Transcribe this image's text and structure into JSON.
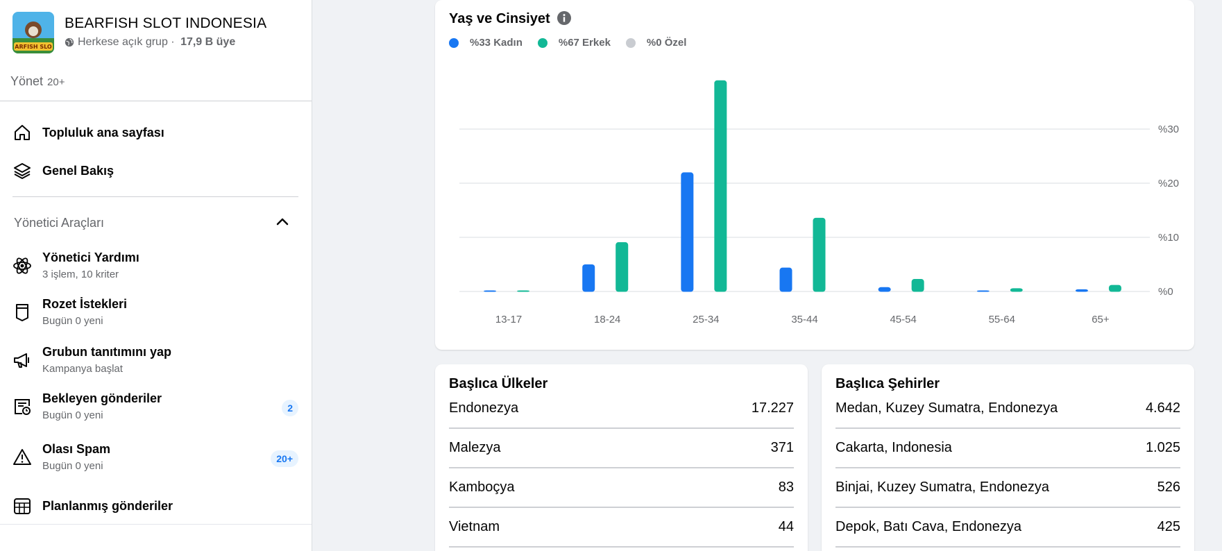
{
  "group": {
    "name": "BEARFISH SLOT INDONESIA",
    "privacy": "Herkese açık grup",
    "separator": " · ",
    "members": "17,9 B üye",
    "thumb_text": "ARFISH SLO"
  },
  "manage": {
    "label": "Yönet",
    "count": "20+"
  },
  "nav_top": [
    {
      "label": "Topluluk ana sayfası",
      "icon": "home-icon"
    },
    {
      "label": "Genel Bakış",
      "icon": "layers-icon"
    }
  ],
  "admin_tools": {
    "title": "Yönetici Araçları",
    "items": [
      {
        "label": "Yönetici Yardımı",
        "sub": "3 işlem, 10 kriter",
        "icon": "atom-icon",
        "badge": ""
      },
      {
        "label": "Rozet İstekleri",
        "sub": "Bugün 0 yeni",
        "icon": "badge-shield-icon",
        "badge": ""
      },
      {
        "label": "Grubun tanıtımını yap",
        "sub": "Kampanya başlat",
        "icon": "megaphone-icon",
        "badge": ""
      },
      {
        "label": "Bekleyen gönderiler",
        "sub": "Bugün 0 yeni",
        "icon": "pending-posts-icon",
        "badge": "2"
      },
      {
        "label": "Olası Spam",
        "sub": "Bugün 0 yeni",
        "icon": "warning-icon",
        "badge": "20+"
      },
      {
        "label": "Planlanmış gönderiler",
        "sub": "",
        "icon": "calendar-grid-icon",
        "badge": ""
      }
    ]
  },
  "age_gender": {
    "title": "Yaş ve Cinsiyet",
    "legend": [
      {
        "label": "%33 Kadın",
        "color": "#1877f2"
      },
      {
        "label": "%67 Erkek",
        "color": "#12b896"
      },
      {
        "label": "%0 Özel",
        "color": "#c9ccd1"
      }
    ]
  },
  "chart_data": {
    "type": "bar",
    "categories": [
      "13-17",
      "18-24",
      "25-34",
      "35-44",
      "45-54",
      "55-64",
      "65+"
    ],
    "series": [
      {
        "name": "Kadın",
        "color": "#1877f2",
        "values": [
          0.1,
          5.0,
          22.0,
          4.4,
          0.8,
          0.2,
          0.4
        ]
      },
      {
        "name": "Erkek",
        "color": "#12b896",
        "values": [
          0.2,
          9.1,
          39.0,
          13.6,
          2.3,
          0.6,
          1.2
        ]
      }
    ],
    "y_ticks": [
      {
        "value": 0,
        "label": "%0"
      },
      {
        "value": 10,
        "label": "%10"
      },
      {
        "value": 20,
        "label": "%20"
      },
      {
        "value": 30,
        "label": "%30"
      }
    ],
    "ylim": [
      0,
      40
    ],
    "grid": true
  },
  "countries": {
    "title": "Başlıca Ülkeler",
    "rows": [
      {
        "name": "Endonezya",
        "value": "17.227"
      },
      {
        "name": "Malezya",
        "value": "371"
      },
      {
        "name": "Kamboçya",
        "value": "83"
      },
      {
        "name": "Vietnam",
        "value": "44"
      }
    ]
  },
  "cities": {
    "title": "Başlıca Şehirler",
    "rows": [
      {
        "name": "Medan, Kuzey Sumatra, Endonezya",
        "value": "4.642"
      },
      {
        "name": "Cakarta, Indonesia",
        "value": "1.025"
      },
      {
        "name": "Binjai, Kuzey Sumatra, Endonezya",
        "value": "526"
      },
      {
        "name": "Depok, Batı Cava, Endonezya",
        "value": "425"
      }
    ]
  }
}
